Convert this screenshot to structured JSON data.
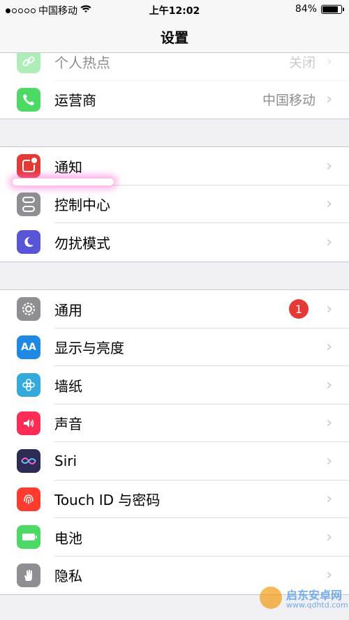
{
  "status_bar": {
    "carrier": "中国移动",
    "time": "上午12:02",
    "battery_percent": "84%",
    "battery_level": 0.84
  },
  "nav": {
    "title": "设置"
  },
  "groups": [
    {
      "items": [
        {
          "label": "个人热点",
          "value": "关闭",
          "icon": "hotspot-icon",
          "color": "#4cd964"
        },
        {
          "label": "运营商",
          "value": "中国移动",
          "icon": "phone-icon",
          "color": "#4cd964"
        }
      ]
    },
    {
      "items": [
        {
          "label": "通知",
          "icon": "notification-icon",
          "color": "#e53935"
        },
        {
          "label": "控制中心",
          "icon": "control-center-icon",
          "color": "#8e8e93"
        },
        {
          "label": "勿扰模式",
          "icon": "moon-icon",
          "color": "#5856d6"
        }
      ]
    },
    {
      "items": [
        {
          "label": "通用",
          "badge": "1",
          "icon": "gear-icon",
          "color": "#8e8e93"
        },
        {
          "label": "显示与亮度",
          "icon": "aa-text-icon",
          "color": "#1e88e5"
        },
        {
          "label": "墙纸",
          "icon": "flower-icon",
          "color": "#34aadc"
        },
        {
          "label": "声音",
          "icon": "speaker-icon",
          "color": "#ff2d55"
        },
        {
          "label": "Siri",
          "icon": "siri-icon",
          "color": "#2c2c54"
        },
        {
          "label": "Touch ID 与密码",
          "icon": "fingerprint-icon",
          "color": "#ff3b30"
        },
        {
          "label": "电池",
          "icon": "battery-icon",
          "color": "#4cd964"
        },
        {
          "label": "隐私",
          "icon": "hand-icon",
          "color": "#8e8e93"
        }
      ]
    }
  ],
  "icon_glyphs": {
    "aa": "AA"
  },
  "watermark": {
    "brand": "启东安卓网",
    "url": "www.qdhtd.com"
  }
}
